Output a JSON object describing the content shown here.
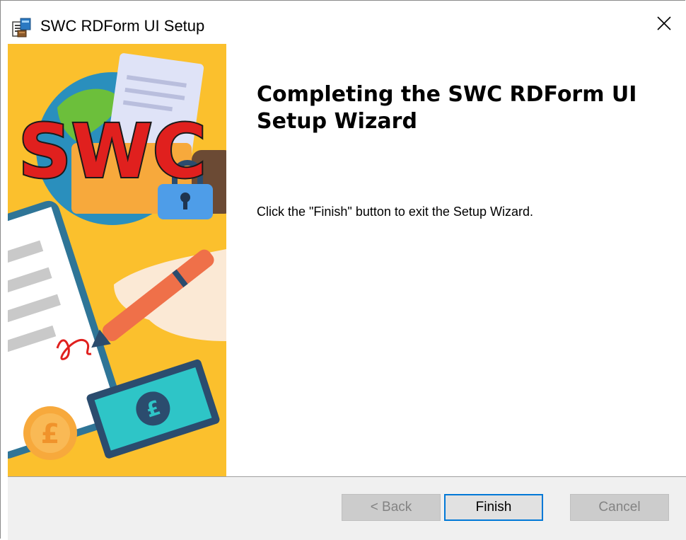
{
  "window": {
    "title": "SWC RDForm UI Setup",
    "close_glyph": "✕"
  },
  "banner": {
    "logo_text": "SWC",
    "currency_symbol": "£",
    "colors": {
      "background": "#fbc02d",
      "logo_red": "#e0201e",
      "ocean": "#2a8fbd",
      "land": "#6cbf3b",
      "pen": "#ef7049",
      "banknote": "#2ec5c7"
    }
  },
  "content": {
    "heading": "Completing the SWC RDForm UI Setup Wizard",
    "message": "Click the \"Finish\" button to exit the Setup Wizard."
  },
  "buttons": {
    "back": "< Back",
    "finish": "Finish",
    "cancel": "Cancel"
  },
  "colors": {
    "focus_border": "#0078d7",
    "footer_bg": "#f0f0f0",
    "disabled_text": "#838383"
  }
}
